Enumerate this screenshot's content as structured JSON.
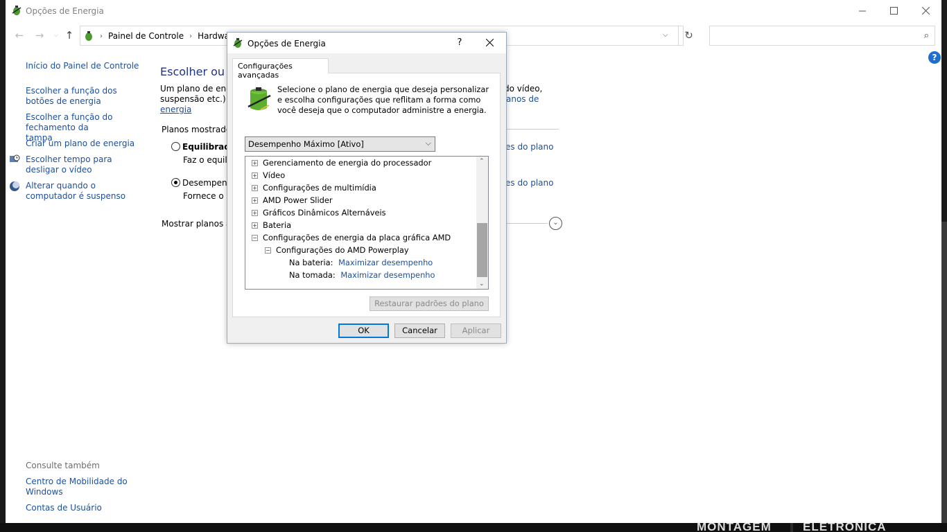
{
  "window": {
    "title": "Opções de Energia"
  },
  "address_bar": {
    "crumbs": [
      "Painel de Controle",
      "Hardware"
    ],
    "search_placeholder": ""
  },
  "left_nav": {
    "home_link": "Início do Painel de Controle",
    "items": [
      "Escolher a função dos botões de energia",
      "Escolher a função do fechamento da tampa",
      "Criar um plano de energia",
      "Escolher tempo para desligar o vídeo",
      "Alterar quando o computador é suspenso"
    ],
    "see_also": {
      "heading": "Consulte também",
      "items": [
        "Centro de Mobilidade do Windows",
        "Contas de Usuário"
      ]
    }
  },
  "main": {
    "heading_partial": "Escolher ou pe",
    "intro_line1_left": "Um plano de energ",
    "intro_line1_right": "do vídeo,",
    "intro_line2_left": "suspensão etc.) qu",
    "intro_line2_right_link": "anos de",
    "intro_line3_link": "energia",
    "plans_label_partial": "Planos mostrados",
    "plans": [
      {
        "name_partial": "Equilibrado",
        "desc_partial": "Faz o equilíb",
        "selected": false,
        "link_partial": "es do plano"
      },
      {
        "name_partial": "Desempenh",
        "desc_partial": "Fornece o d",
        "selected": true,
        "link_partial": "es do plano"
      }
    ],
    "more_plans_partial": "Mostrar planos ad"
  },
  "dialog": {
    "title": "Opções de Energia",
    "help": "?",
    "tab": "Configurações avançadas",
    "description": "Selecione o plano de energia que deseja personalizar e escolha configurações que reflitam a forma como você deseja que o computador administre a energia.",
    "plan_selected": "Desempenho Máximo [Ativo]",
    "tree": [
      {
        "label": "Gerenciamento de energia do processador",
        "level": 0,
        "expander": "+"
      },
      {
        "label": "Vídeo",
        "level": 0,
        "expander": "+"
      },
      {
        "label": "Configurações de multimídia",
        "level": 0,
        "expander": "+"
      },
      {
        "label": "AMD Power Slider",
        "level": 0,
        "expander": "+"
      },
      {
        "label": "Gráficos Dinâmicos Alternáveis",
        "level": 0,
        "expander": "+"
      },
      {
        "label": "Bateria",
        "level": 0,
        "expander": "+"
      },
      {
        "label": "Configurações de energia da placa gráfica AMD",
        "level": 0,
        "expander": "−"
      },
      {
        "label": "Configurações do AMD Powerplay",
        "level": 1,
        "expander": "−"
      },
      {
        "label": "Na bateria:",
        "value": "Maximizar desempenho",
        "level": 2
      },
      {
        "label": "Na tomada:",
        "value": "Maximizar desempenho",
        "level": 2
      }
    ],
    "restore_button": "Restaurar padrões do plano",
    "ok": "OK",
    "cancel": "Cancelar",
    "apply": "Aplicar"
  },
  "background_text": [
    "MONTAGEM",
    "ELETRÔNICA"
  ],
  "colors": {
    "link": "#1d4f9b",
    "heading": "#1e3287",
    "accent": "#0078d7"
  }
}
